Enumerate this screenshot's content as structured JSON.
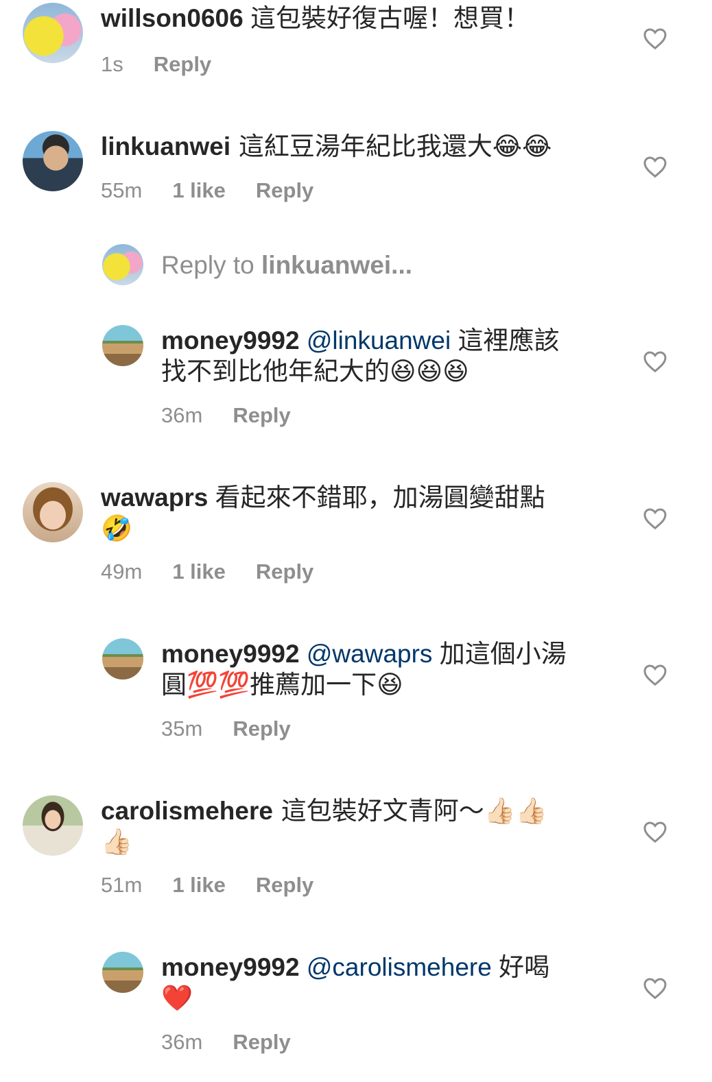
{
  "comments": [
    {
      "user": "willson0606",
      "text": " 這包裝好復古喔！想買！",
      "time": "1s",
      "reply": "Reply"
    },
    {
      "user": "linkuanwei",
      "text": " 這紅豆湯年紀比我還大😂😂",
      "time": "55m",
      "likes": "1 like",
      "reply": "Reply"
    },
    {
      "reply_prompt": "Reply to ",
      "reply_prompt_user": "linkuanwei..."
    },
    {
      "user": "money9992",
      "mention": "@linkuanwei",
      "line1": " 這裡應該",
      "line2": "找不到比他年紀大的😆😆😆",
      "time": "36m",
      "reply": "Reply"
    },
    {
      "user": "wawaprs",
      "line1": " 看起來不錯耶，加湯圓變甜點",
      "line2": "🤣",
      "time": "49m",
      "likes": "1 like",
      "reply": "Reply"
    },
    {
      "user": "money9992",
      "mention": "@wawaprs",
      "line1": " 加這個小湯",
      "line2": "圓💯💯推薦加一下😆",
      "time": "35m",
      "reply": "Reply"
    },
    {
      "user": "carolismehere",
      "line1": " 這包裝好文青阿～👍🏻👍🏻",
      "line2": "👍🏻",
      "time": "51m",
      "likes": "1 like",
      "reply": "Reply"
    },
    {
      "user": "money9992",
      "mention": "@carolismehere",
      "line1": " 好喝",
      "line2": "❤️",
      "time": "36m",
      "reply": "Reply"
    }
  ]
}
